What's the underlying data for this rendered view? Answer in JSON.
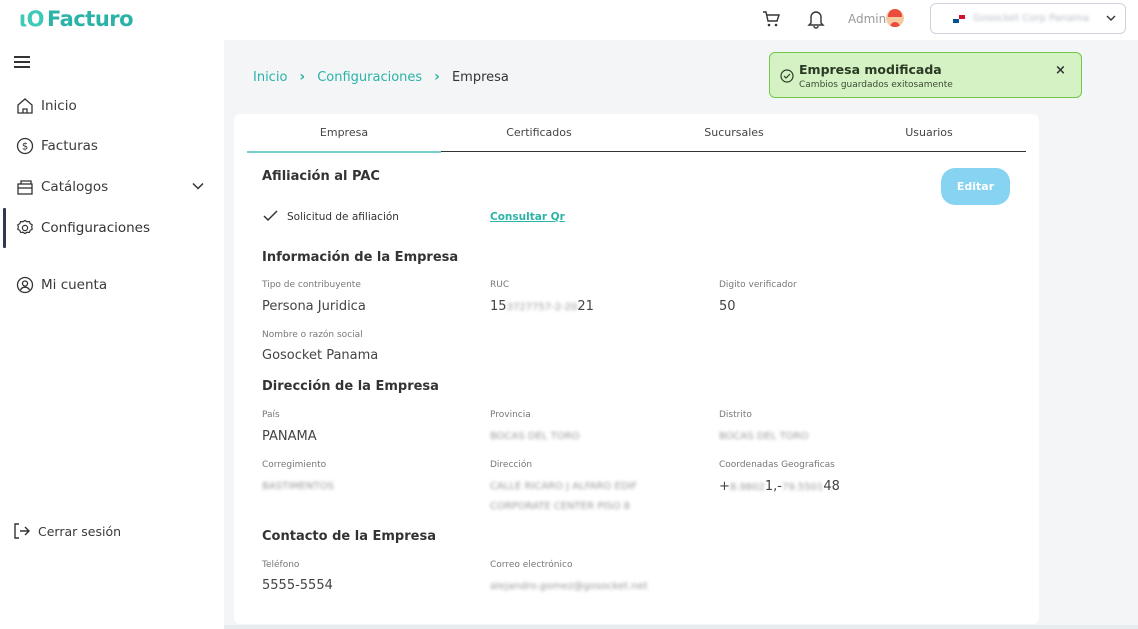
{
  "app": {
    "name": "Facturo"
  },
  "topbar": {
    "admin_label": "Admin",
    "company_name": "Gosocket Corp Panama"
  },
  "sidebar": {
    "items": [
      {
        "label": "Inicio",
        "icon": "home-icon"
      },
      {
        "label": "Facturas",
        "icon": "dollar-icon"
      },
      {
        "label": "Catálogos",
        "icon": "catalog-icon"
      },
      {
        "label": "Configuraciones",
        "icon": "gear-icon",
        "active": true
      },
      {
        "label": "Mi cuenta",
        "icon": "user-icon"
      }
    ],
    "logout_label": "Cerrar sesión"
  },
  "breadcrumb": {
    "items": [
      "Inicio",
      "Configuraciones",
      "Empresa"
    ]
  },
  "toast": {
    "title": "Empresa modificada",
    "message": "Cambios guardados exitosamente",
    "close": "×"
  },
  "tabs": [
    "Empresa",
    "Certificados",
    "Sucursales",
    "Usuarios"
  ],
  "pac": {
    "title": "Afiliación al PAC",
    "request_label": "Solicitud de afiliación",
    "qr_link": "Consultar Qr",
    "edit_label": "Editar"
  },
  "company_info": {
    "title": "Información de la Empresa",
    "taxpayer_type_label": "Tipo de contribuyente",
    "taxpayer_type": "Persona Juridica",
    "ruc_label": "RUC",
    "ruc_prefix": "15",
    "ruc_hidden": "3727757-2-20",
    "ruc_suffix": "21",
    "check_digit_label": "Digito verificador",
    "check_digit": "50",
    "name_label": "Nombre o razón social",
    "name": "Gosocket Panama"
  },
  "address": {
    "title": "Dirección de la Empresa",
    "country_label": "País",
    "country": "PANAMA",
    "province_label": "Provincia",
    "province": "BOCAS DEL TORO",
    "district_label": "Distrito",
    "district": "BOCAS DEL TORO",
    "corregimiento_label": "Corregimiento",
    "corregimiento": "BASTIMENTOS",
    "address_label": "Dirección",
    "address_line1": "CALLE RICARO J ALFARO EDIF",
    "address_line2": "CORPORATE CENTER PISO 8",
    "coords_label": "Coordenadas Geograficas",
    "coords_prefix": "+",
    "coords_hidden_a": "8.9802",
    "coords_mid": "1,-",
    "coords_hidden_b": "79.5501",
    "coords_suffix": "48"
  },
  "contact": {
    "title": "Contacto de la Empresa",
    "phone_label": "Teléfono",
    "phone": "5555-5554",
    "email_label": "Correo electrónico",
    "email": "alejandro.gomez@gosocket.net"
  },
  "colors": {
    "accent": "#2bb3a7",
    "toast_bg": "#d5f2c4",
    "toast_border": "#73c84a",
    "edit_button": "#86d3f2"
  }
}
